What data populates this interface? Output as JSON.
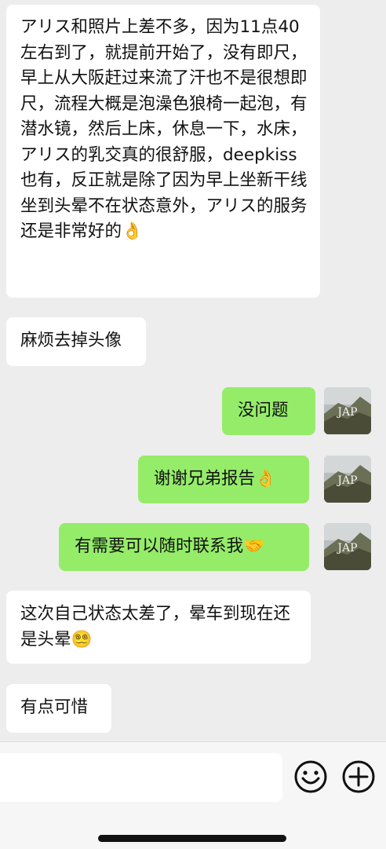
{
  "messages": [
    {
      "side": "in",
      "text": "アリス和照片上差不多，因为11点40左右到了，就提前开始了，没有即尺，早上从大阪赶过来流了汗也不是很想即尺，流程大概是泡澡色狼椅一起泡，有潜水镜，然后上床，休息一下，水床，アリス的乳交真的很舒服，deepkiss也有，反正就是除了因为早上坐新干线坐到头晕不在状态意外，アリス的服务还是非常好的",
      "emoji": "👌"
    },
    {
      "side": "in",
      "text": "麻烦去掉头像",
      "emoji": ""
    },
    {
      "side": "out",
      "text": "没问题",
      "emoji": ""
    },
    {
      "side": "out",
      "text": "谢谢兄弟报告",
      "emoji": "👌"
    },
    {
      "side": "out",
      "text": "有需要可以随时联系我",
      "emoji": "🤝"
    },
    {
      "side": "in",
      "text": "这次自己状态太差了，晕车到现在还是头晕",
      "emoji": "😵‍💫"
    },
    {
      "side": "in",
      "text": "有点可惜",
      "emoji": ""
    }
  ],
  "avatar": {
    "label": "JAP",
    "icon": "mountain-avatar"
  },
  "input_bar": {
    "value": "",
    "emoji_icon": "smiley-icon",
    "plus_icon": "plus-circle-icon"
  },
  "colors": {
    "background": "#ededed",
    "incoming_bubble": "#ffffff",
    "outgoing_bubble": "#95ec69"
  }
}
